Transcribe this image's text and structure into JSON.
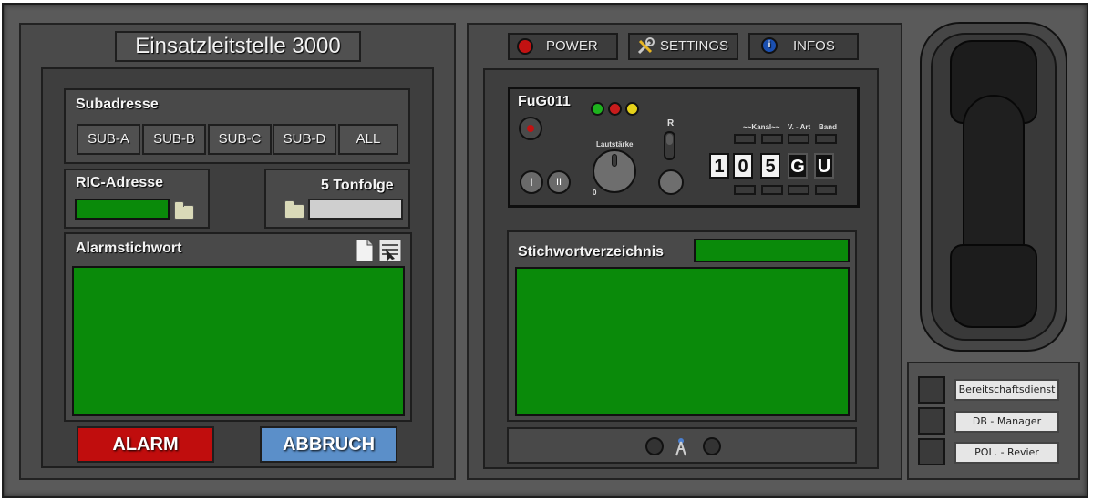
{
  "app": {
    "title": "Einsatzleitstelle 3000"
  },
  "left": {
    "subadresse": {
      "label": "Subadresse",
      "buttons": [
        "SUB-A",
        "SUB-B",
        "SUB-C",
        "SUB-D",
        "ALL"
      ]
    },
    "ric": {
      "label": "RIC-Adresse"
    },
    "tonfolge": {
      "label": "5 Tonfolge"
    },
    "alarmstichwort": {
      "label": "Alarmstichwort"
    },
    "alarm_label": "ALARM",
    "abbruch_label": "ABBRUCH"
  },
  "top_buttons": {
    "power": "POWER",
    "settings": "SETTINGS",
    "infos": "INFOS"
  },
  "radio": {
    "model": "FuG011",
    "volume_label": "Lautstärke",
    "volume_zero": "0",
    "r_label": "R",
    "kanal_label": "~~Kanal~~",
    "vart_label": "V. - Art",
    "band_label": "Band",
    "btn_one": "I",
    "btn_two": "II",
    "digits": [
      "1",
      "0",
      "5",
      "G",
      "U"
    ]
  },
  "stichwort": {
    "label": "Stichwortverzeichnis"
  },
  "side": {
    "buttons": [
      "Bereitschaftsdienst",
      "DB - Manager",
      "POL. - Revier"
    ]
  },
  "colors": {
    "lcd_green": "#0a8a0a",
    "alarm_red": "#c00d0d",
    "abbruch_blue": "#5b8fc9",
    "led_green": "#1db31d",
    "led_red": "#c81c1c",
    "led_yellow": "#e6d21a"
  }
}
